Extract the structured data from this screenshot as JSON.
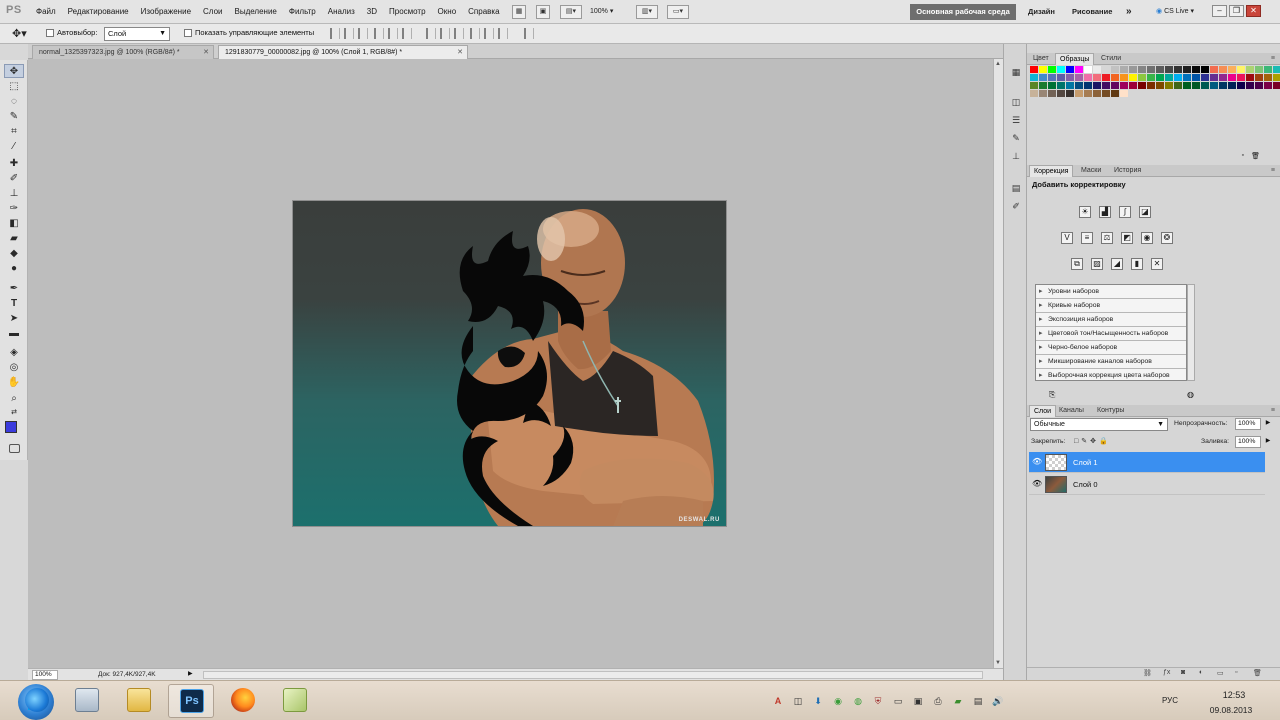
{
  "app": {
    "logo": "PS"
  },
  "menu": [
    "Файл",
    "Редактирование",
    "Изображение",
    "Слои",
    "Выделение",
    "Фильтр",
    "Анализ",
    "3D",
    "Просмотр",
    "Окно",
    "Справка"
  ],
  "menubar": {
    "zoom": "100%",
    "workspaces": {
      "active": "Основная рабочая среда",
      "design": "Дизайн",
      "drawing": "Рисование",
      "more": "»"
    },
    "cslive": "CS Live",
    "window_controls": {
      "minimize": "–",
      "restore": "❐",
      "close": "✕"
    }
  },
  "options": {
    "autoselect_label": "Автовыбор:",
    "layer_target": "Слой",
    "show_controls_label": "Показать управляющие элементы"
  },
  "document_tabs": [
    {
      "label": "normal_1325397323.jpg @ 100% (RGB/8#) *",
      "active": false
    },
    {
      "label": "1291830779_00000082.jpg @ 100% (Слой 1, RGB/8#) *",
      "active": true
    }
  ],
  "canvas": {
    "watermark": "DESWAL.RU"
  },
  "status": {
    "zoom": "100%",
    "doc": "Док: 927,4K/927,4K"
  },
  "colors": {
    "foreground": "#3b3bdd",
    "background": "#ffffff",
    "selection": "#3a8ff0"
  },
  "swatches_panel": {
    "tabs": [
      "Цвет",
      "Образцы",
      "Стили"
    ],
    "active_tab": "Образцы"
  },
  "adjustments_panel": {
    "tabs": [
      "Коррекция",
      "Маски",
      "История"
    ],
    "active_tab": "Коррекция",
    "title": "Добавить корректировку",
    "presets": [
      "Уровни наборов",
      "Кривые наборов",
      "Экспозиция наборов",
      "Цветовой тон/Насыщенность наборов",
      "Черно-белое наборов",
      "Микширование каналов наборов",
      "Выборочная коррекция цвета наборов"
    ]
  },
  "layers_panel": {
    "tabs": [
      "Слои",
      "Каналы",
      "Контуры"
    ],
    "active_tab": "Слои",
    "blend_mode": "Обычные",
    "opacity_label": "Непрозрачность:",
    "opacity": "100%",
    "lock_label": "Закрепить:",
    "fill_label": "Заливка:",
    "fill": "100%",
    "layers": [
      {
        "name": "Слой 1",
        "selected": true,
        "visible": true
      },
      {
        "name": "Слой 0",
        "selected": false,
        "visible": true
      }
    ]
  },
  "taskbar": {
    "lang": "РУС",
    "time": "12:53",
    "date": "09.08.2013",
    "apps": [
      "ie-icon",
      "calculator-icon",
      "explorer-icon",
      "photoshop-icon",
      "firefox-icon",
      "notes-icon"
    ],
    "photoshop_label": "Ps"
  }
}
